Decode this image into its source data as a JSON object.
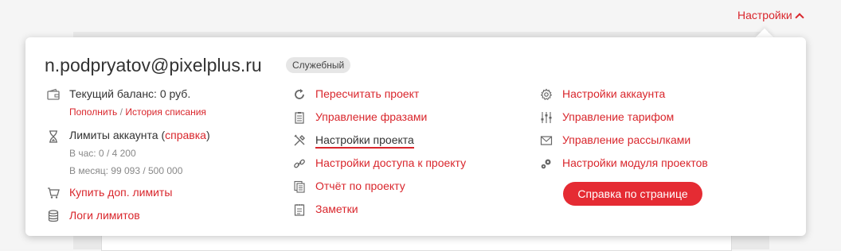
{
  "header": {
    "settings_label": "Настройки"
  },
  "account": {
    "email": "n.podpryatov@pixelplus.ru",
    "badge": "Служебный",
    "balance_label": "Текущий баланс: 0 руб.",
    "topup_link": "Пополнить",
    "separator": "/",
    "history_link": "История списания",
    "limits_label": "Лимиты аккаунта (",
    "limits_help_link": "справка",
    "limits_close": ")",
    "per_hour": "В час: 0 / 4 200",
    "per_month": "В месяц: 99 093 / 500 000",
    "buy_limits": "Купить доп. лимиты",
    "limit_logs": "Логи лимитов"
  },
  "project": {
    "items": [
      "Пересчитать проект",
      "Управление фразами",
      "Настройки проекта",
      "Настройки доступа к проекту",
      "Отчёт по проекту",
      "Заметки"
    ]
  },
  "settings": {
    "items": [
      "Настройки аккаунта",
      "Управление тарифом",
      "Управление рассылками",
      "Настройки модуля проектов"
    ],
    "help_button": "Справка по странице"
  }
}
